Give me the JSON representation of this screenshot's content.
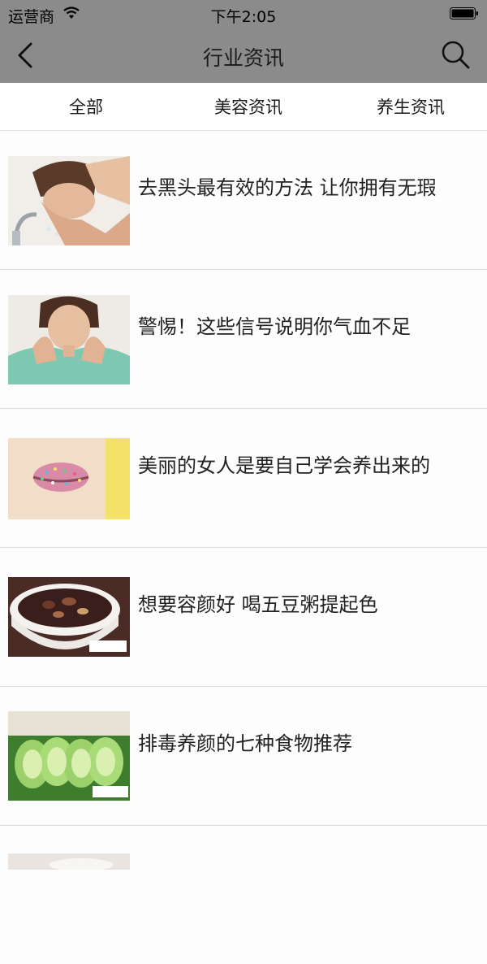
{
  "status_bar": {
    "carrier": "运营商",
    "time": "下午2:05"
  },
  "nav": {
    "title": "行业资讯",
    "back_icon": "chevron-left-icon",
    "search_icon": "search-icon"
  },
  "tabs": [
    {
      "label": "全部"
    },
    {
      "label": "美容资讯"
    },
    {
      "label": "养生资讯"
    }
  ],
  "articles": [
    {
      "title": "去黑头最有效的方法 让你拥有无瑕",
      "thumb": "face-washing-image"
    },
    {
      "title": "警惕！这些信号说明你气血不足",
      "thumb": "tired-woman-image"
    },
    {
      "title": "美丽的女人是要自己学会养出来的",
      "thumb": "sprinkle-lips-image"
    },
    {
      "title": "想要容颜好 喝五豆粥提起色",
      "thumb": "bean-porridge-image"
    },
    {
      "title": "排毒养颜的七种食物推荐",
      "thumb": "cucumber-slices-image"
    }
  ],
  "colors": {
    "nav_bg": "#8b8b8b",
    "divider": "#dcdcdc"
  }
}
